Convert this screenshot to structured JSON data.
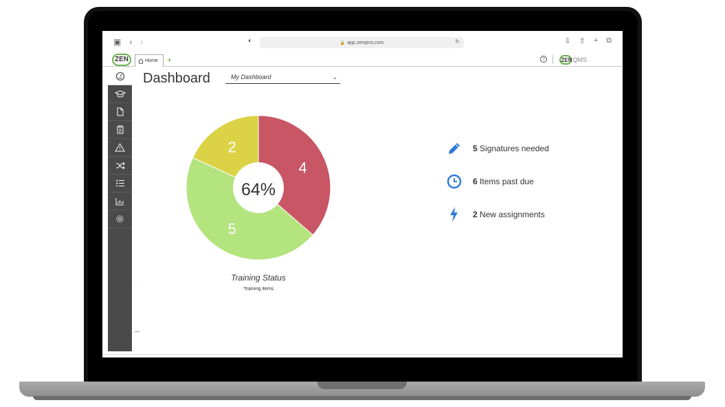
{
  "browser": {
    "url": "app.zenqms.com"
  },
  "header": {
    "logo_text": "ZEN",
    "logo_sub": "QMS",
    "home_tab_label": "Home",
    "add_tab_label": "+",
    "help_label": "?",
    "brand_zen": "ZEN",
    "brand_qms": "QMS"
  },
  "page": {
    "title": "Dashboard",
    "dashboard_select": "My Dashboard"
  },
  "sidebar": {
    "items": [
      {
        "name": "dashboard-icon"
      },
      {
        "name": "training-icon"
      },
      {
        "name": "document-icon"
      },
      {
        "name": "clipboard-icon"
      },
      {
        "name": "warning-icon"
      },
      {
        "name": "shuffle-icon"
      },
      {
        "name": "checklist-icon"
      },
      {
        "name": "chart-icon"
      },
      {
        "name": "gear-icon"
      }
    ]
  },
  "chart_data": {
    "type": "pie",
    "title": "Training Status",
    "subtitle": "*training items",
    "center_label": "64%",
    "slices": [
      {
        "value": 4,
        "label": "4",
        "color": "#c85664"
      },
      {
        "value": 5,
        "label": "5",
        "color": "#b3e47e"
      },
      {
        "value": 2,
        "label": "2",
        "color": "#dbd245"
      }
    ]
  },
  "summary": [
    {
      "count": "5",
      "text": "Signatures needed",
      "icon": "pencil-icon"
    },
    {
      "count": "6",
      "text": "Items past due",
      "icon": "clock-icon"
    },
    {
      "count": "2",
      "text": "New assignments",
      "icon": "lightning-icon"
    }
  ],
  "colors": {
    "accent": "#2f7bd9",
    "brand_green": "#6ab04c",
    "sidebar": "#4a4a4a"
  }
}
